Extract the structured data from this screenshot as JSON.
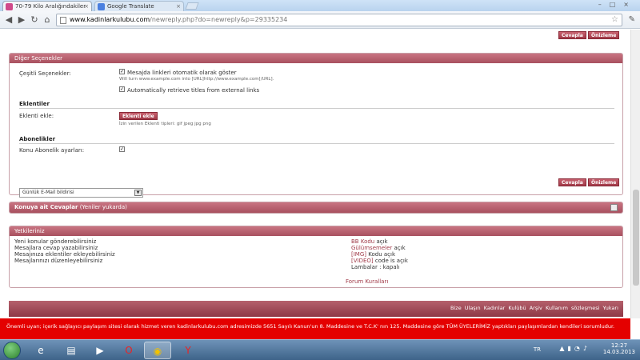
{
  "browser": {
    "tabs": [
      {
        "label": "70-79 Kilo Aralığındakiler",
        "active": true
      },
      {
        "label": "Google Translate",
        "active": false
      }
    ],
    "url_host": "www.kadinlarkulubu.com",
    "url_rest": "/newreply.php?do=newreply&p=29335234"
  },
  "buttons": {
    "reply": "Cevapla",
    "preview": "Önizleme"
  },
  "other_options": {
    "title": "Diğer Seçenekler",
    "misc_label": "Çeşitli Seçenekler:",
    "auto_links_label": "Mesajda linkleri otomatik olarak göster",
    "auto_links_hint": "Will turn www.example.com into [URL]http://www.example.com[/URL].",
    "retrieve_titles_label": "Automatically retrieve titles from external links",
    "attachments_title": "Eklentiler",
    "attach_label": "Eklenti ekle:",
    "attach_button": "Eklenti ekle",
    "attach_hint": "İzin verilen Eklenti tipleri: gif jpeg jpg png",
    "subscriptions_title": "Abonelikler",
    "subscription_label": "Konu Abonelik ayarları:",
    "subscription_select": "Günlük E-Mail bildirisi"
  },
  "thread_replies": {
    "title_bold": "Konuya ait Cevaplar",
    "title_rest": "(Yeniler yukarda)"
  },
  "permissions": {
    "title": "Yetkileriniz",
    "left": [
      "Yeni konular gönderebilirsiniz",
      "Mesajlara cevap yazabilirsiniz",
      "Mesajınıza eklentiler ekleyebilirsiniz",
      "Mesajlarınızı düzenleyebilirsiniz"
    ],
    "right": [
      {
        "link": "BB Kodu",
        "text": "açık"
      },
      {
        "link": "Gülümsemeler",
        "text": "açık"
      },
      {
        "link": "[IMG]",
        "text": "Kodu açık"
      },
      {
        "link": "[VIDEO]",
        "text": "code is açık"
      },
      {
        "link": "",
        "text": "Lambalar : kapalı"
      }
    ],
    "forum_rules": "Forum Kuralları"
  },
  "footer": {
    "links": [
      "Bize Ulaşın",
      "Kadınlar Kulübü",
      "Arşiv",
      "Kullanım sözleşmesi",
      "Yukarı"
    ]
  },
  "warning": "Önemli uyarı; içerik sağlayıcı paylaşım sitesi olarak hizmet veren kadinlarkulubu.com adresimizde 5651 Sayılı Kanun'un 8. Maddesine ve T.C.K' nın 125. Maddesine göre TÜM ÜYELERİMİZ yaptıkları paylaşımlardan kendileri sorumludur.",
  "taskbar": {
    "lang": "TR",
    "time": "12:27",
    "date": "14.03.2013"
  },
  "colors": {
    "accent": "#a8505f",
    "warning_bg": "#e40000"
  }
}
